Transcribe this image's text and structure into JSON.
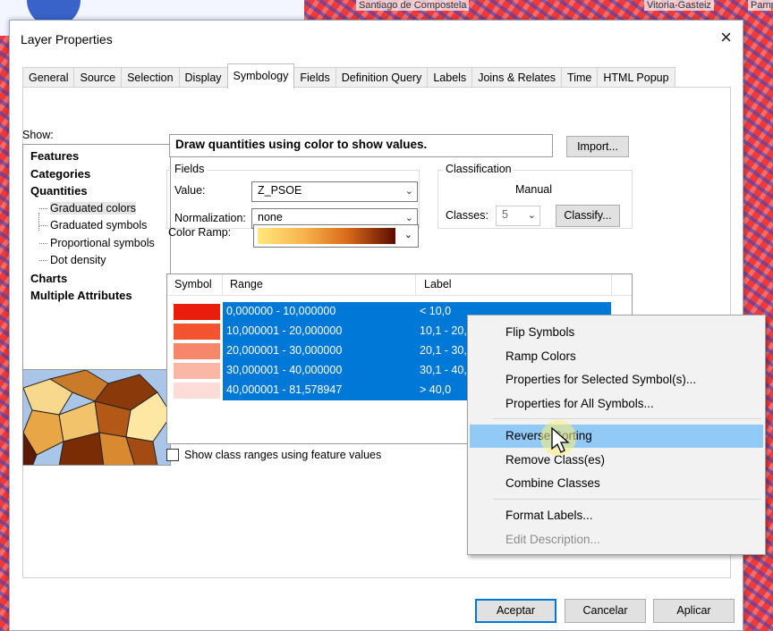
{
  "background": {
    "map_labels": [
      "Santiago de Compostela",
      "Vitoria-Gasteiz",
      "Pamp"
    ]
  },
  "dialog": {
    "title": "Layer Properties",
    "close_glyph": "×",
    "tabs": [
      "General",
      "Source",
      "Selection",
      "Display",
      "Symbology",
      "Fields",
      "Definition Query",
      "Labels",
      "Joins & Relates",
      "Time",
      "HTML Popup"
    ],
    "active_tab": "Symbology"
  },
  "show": {
    "label": "Show:",
    "items": [
      {
        "label": "Features",
        "bold": true
      },
      {
        "label": "Categories",
        "bold": true
      },
      {
        "label": "Quantities",
        "bold": true
      },
      {
        "label": "Graduated colors",
        "sub": true,
        "selected": true
      },
      {
        "label": "Graduated symbols",
        "sub": true
      },
      {
        "label": "Proportional symbols",
        "sub": true
      },
      {
        "label": "Dot density",
        "sub": true
      },
      {
        "label": "Charts",
        "bold": true
      },
      {
        "label": "Multiple Attributes",
        "bold": true
      }
    ]
  },
  "symbology": {
    "description": "Draw quantities using color to show values.",
    "import_label": "Import...",
    "fields": {
      "title": "Fields",
      "value_label": "Value:",
      "value": "Z_PSOE",
      "normalization_label": "Normalization:",
      "normalization": "none"
    },
    "classification": {
      "title": "Classification",
      "method": "Manual",
      "classes_label": "Classes:",
      "classes": "5",
      "classify_label": "Classify..."
    },
    "color_ramp_label": "Color Ramp:",
    "columns": [
      "Symbol",
      "Range",
      "Label"
    ],
    "classes_rows": [
      {
        "color": "#ea1c0c",
        "range": "0,000000 - 10,000000",
        "label": "< 10,0"
      },
      {
        "color": "#f3532f",
        "range": "10,000001 - 20,000000",
        "label": "10,1 - 20,"
      },
      {
        "color": "#f7876a",
        "range": "20,000001 - 30,000000",
        "label": "20,1 - 30,"
      },
      {
        "color": "#fab7a5",
        "range": "30,000001 - 40,000000",
        "label": "30,1 - 40,"
      },
      {
        "color": "#fbdcd6",
        "range": "40,000001 - 81,578947",
        "label": "> 40,0"
      }
    ],
    "show_class_ranges_label": "Show class ranges using feature values",
    "show_class_ranges_checked": false
  },
  "footer": {
    "ok_label": "Aceptar",
    "cancel_label": "Cancelar",
    "apply_label": "Aplicar"
  },
  "context_menu": {
    "items": [
      {
        "label": "Flip Symbols"
      },
      {
        "label": "Ramp Colors"
      },
      {
        "label": "Properties for Selected Symbol(s)..."
      },
      {
        "label": "Properties for All Symbols..."
      },
      {
        "label": "Reverse Sorting",
        "hover": true
      },
      {
        "label": "Remove Class(es)"
      },
      {
        "label": "Combine Classes"
      },
      {
        "label": "Format Labels..."
      },
      {
        "label": "Edit Description...",
        "disabled": true
      }
    ]
  }
}
